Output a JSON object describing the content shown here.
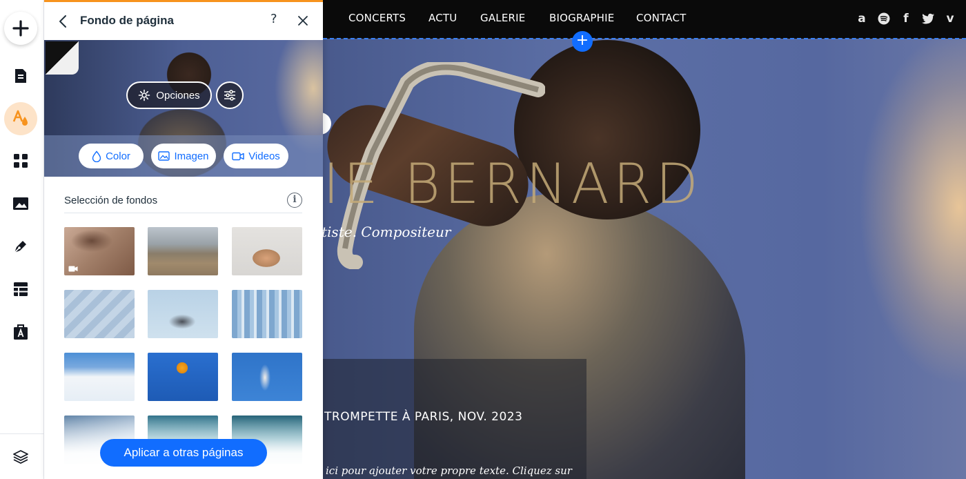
{
  "site": {
    "nav": {
      "items": [
        {
          "label": "CONCERTS"
        },
        {
          "label": "ACTU"
        },
        {
          "label": "GALERIE"
        },
        {
          "label": "BIOGRAPHIE"
        },
        {
          "label": "CONTACT"
        }
      ],
      "social_icons": [
        "amazon-icon",
        "spotify-icon",
        "facebook-icon",
        "twitter-icon",
        "vimeo-icon"
      ]
    },
    "hero": {
      "title": "IE BERNARD",
      "subtitle": "tiste. Compositeur",
      "news": "TROMPETTE À PARIS, NOV. 2023",
      "paragraph": "ici pour ajouter votre propre texte. Cliquez sur"
    },
    "add_strip_label": "+"
  },
  "toolbar": {
    "items": [
      {
        "icon": "add-icon"
      },
      {
        "icon": "pages-icon"
      },
      {
        "icon": "design-icon",
        "active": true
      },
      {
        "icon": "apps-icon"
      },
      {
        "icon": "media-icon"
      },
      {
        "icon": "blog-pen-icon"
      },
      {
        "icon": "table-icon"
      },
      {
        "icon": "business-icon"
      }
    ],
    "bottom_icon": "layers-icon",
    "active_color": "#fde3c8",
    "accent_color": "#f7931e"
  },
  "panel": {
    "title": "Fondo de página",
    "help": "?",
    "options_label": "Opciones",
    "tabs": [
      {
        "label": "Color",
        "icon": "drop-icon"
      },
      {
        "label": "Imagen",
        "icon": "image-icon"
      },
      {
        "label": "Videos",
        "icon": "video-icon"
      }
    ],
    "section_label": "Selección de fondos",
    "info": "i",
    "thumbnails": [
      {
        "name": "leaf-shadow",
        "video": true
      },
      {
        "name": "mountain-landscape"
      },
      {
        "name": "yoga-pose"
      },
      {
        "name": "blue-pattern"
      },
      {
        "name": "stretching-pose"
      },
      {
        "name": "glass-building"
      },
      {
        "name": "greek-stairs"
      },
      {
        "name": "orange-sculpture"
      },
      {
        "name": "tennis-player"
      },
      {
        "name": "glass-tower"
      },
      {
        "name": "ocean-wave"
      },
      {
        "name": "sea-surface"
      }
    ],
    "apply_label": "Aplicar a otras páginas",
    "primary_color": "#116dff"
  }
}
